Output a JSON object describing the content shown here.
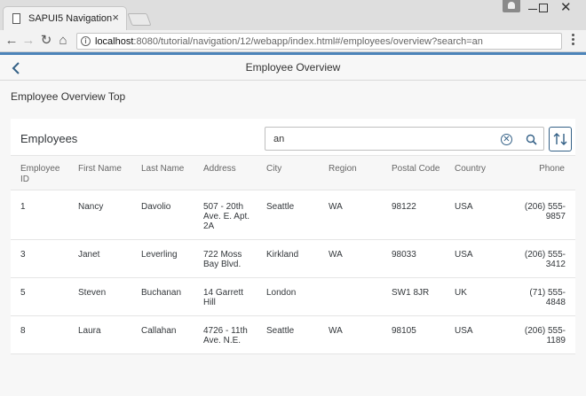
{
  "browser": {
    "tab_title": "SAPUI5 Navigation",
    "tab_close": "×",
    "url_host": "localhost",
    "url_rest": ":8080/tutorial/navigation/12/webapp/index.html#/employees/overview?search=an"
  },
  "app": {
    "title": "Employee Overview",
    "subtitle": "Employee Overview Top"
  },
  "panel": {
    "title": "Employees",
    "search_value": "an"
  },
  "table": {
    "columns": [
      "Employee ID",
      "First Name",
      "Last Name",
      "Address",
      "City",
      "Region",
      "Postal Code",
      "Country",
      "Phone"
    ],
    "rows": [
      {
        "id": "1",
        "first": "Nancy",
        "last": "Davolio",
        "address": "507 - 20th Ave. E. Apt. 2A",
        "city": "Seattle",
        "region": "WA",
        "postal": "98122",
        "country": "USA",
        "phone": "(206) 555-9857"
      },
      {
        "id": "3",
        "first": "Janet",
        "last": "Leverling",
        "address": "722 Moss Bay Blvd.",
        "city": "Kirkland",
        "region": "WA",
        "postal": "98033",
        "country": "USA",
        "phone": "(206) 555-3412"
      },
      {
        "id": "5",
        "first": "Steven",
        "last": "Buchanan",
        "address": "14 Garrett Hill",
        "city": "London",
        "region": "",
        "postal": "SW1 8JR",
        "country": "UK",
        "phone": "(71) 555-4848"
      },
      {
        "id": "8",
        "first": "Laura",
        "last": "Callahan",
        "address": "4726 - 11th Ave. N.E.",
        "city": "Seattle",
        "region": "WA",
        "postal": "98105",
        "country": "USA",
        "phone": "(206) 555-1189"
      }
    ]
  },
  "colors": {
    "accent": "#346187",
    "header_bar": "#4c84b9"
  }
}
